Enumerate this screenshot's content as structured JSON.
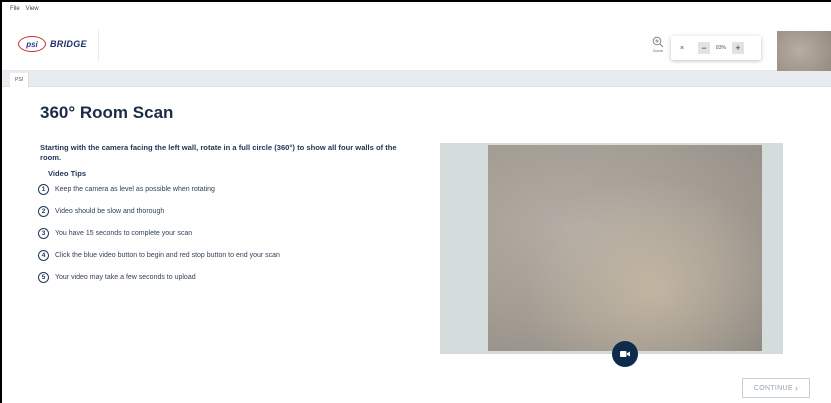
{
  "menu": {
    "file": "File",
    "view": "View"
  },
  "brand": {
    "logo_mark": "psi",
    "logo_text": "BRIDGE"
  },
  "zoom": {
    "button_label": "Zoom",
    "close": "×",
    "minus": "−",
    "level": "83%",
    "plus": "+"
  },
  "tab": {
    "label": "PSI"
  },
  "page": {
    "title": "360° Room Scan",
    "instruction": "Starting with the camera facing the left wall, rotate in a full circle (360°) to show all four walls of the room.",
    "tips_heading": "Video Tips",
    "tips": [
      {
        "num": "1",
        "text": "Keep the camera as level as possible when rotating"
      },
      {
        "num": "2",
        "text": "Video should be slow and thorough"
      },
      {
        "num": "3",
        "text": "You have  15  seconds to complete your scan"
      },
      {
        "num": "4",
        "text": "Click the blue video button to begin and red stop button to end your scan"
      },
      {
        "num": "5",
        "text": "Your video may take a few seconds to upload"
      }
    ]
  },
  "continue_label": "CONTINUE",
  "icons": {
    "zoom": "zoom-in-icon",
    "record": "video-camera-icon",
    "continue": "chevron-right-icon"
  },
  "colors": {
    "accent_dark": "#0e2a4d",
    "logo_red": "#c9302c",
    "logo_blue": "#1e2d6b"
  }
}
